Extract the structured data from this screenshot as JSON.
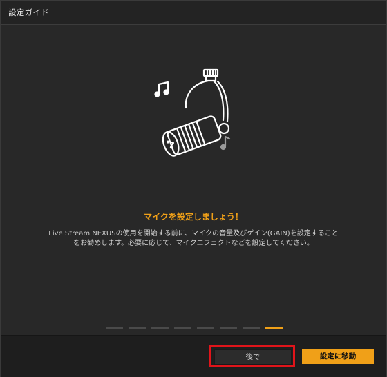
{
  "window": {
    "title": "設定ガイド"
  },
  "content": {
    "heading": "マイクを設定しましょう！",
    "description": "Live Stream NEXUSの使用を開始する前に、マイクの音量及びゲイン(GAIN)を設定することをお勧めします。必要に応じて、マイクエフェクトなどを設定してください。",
    "illustration_icon": "microphone-icon",
    "note_icons": [
      "music-note-icon",
      "music-note-icon"
    ]
  },
  "pager": {
    "total_steps": 8,
    "current_step": 8
  },
  "footer": {
    "later_label": "後で",
    "go_label": "設定に移動"
  },
  "colors": {
    "accent": "#f0a018",
    "highlight": "#e0141a",
    "background": "#282828",
    "footer": "#1e1e1e"
  }
}
